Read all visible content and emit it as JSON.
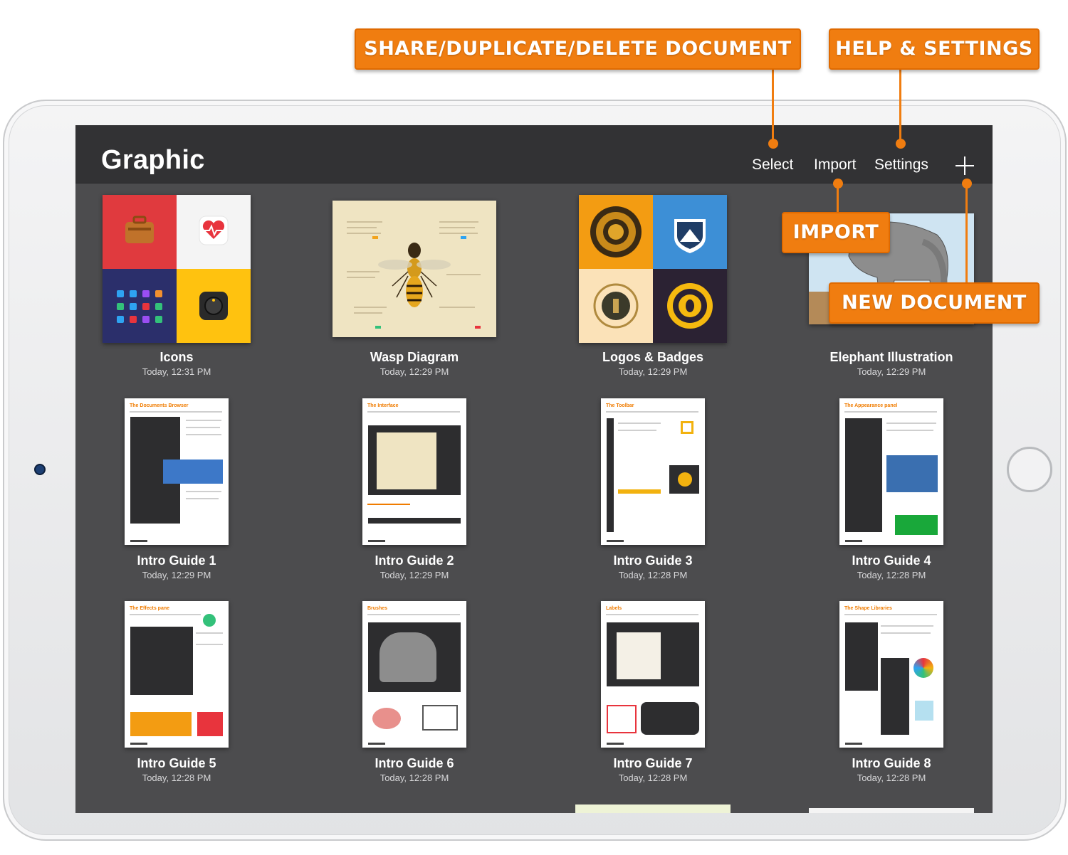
{
  "app": {
    "title": "Graphic"
  },
  "toolbar": {
    "select_label": "Select",
    "import_label": "Import",
    "settings_label": "Settings",
    "new_icon": "plus-icon"
  },
  "documents": [
    {
      "name": "Icons",
      "date": "Today, 12:31 PM"
    },
    {
      "name": "Wasp Diagram",
      "date": "Today, 12:29 PM"
    },
    {
      "name": "Logos & Badges",
      "date": "Today, 12:29 PM"
    },
    {
      "name": "Elephant Illustration",
      "date": "Today, 12:29 PM"
    },
    {
      "name": "Intro Guide 1",
      "date": "Today, 12:29 PM",
      "page_title": "The Documents Browser"
    },
    {
      "name": "Intro Guide 2",
      "date": "Today, 12:29 PM",
      "page_title": "The Interface"
    },
    {
      "name": "Intro Guide 3",
      "date": "Today, 12:28 PM",
      "page_title": "The Toolbar"
    },
    {
      "name": "Intro Guide 4",
      "date": "Today, 12:28 PM",
      "page_title": "The Appearance panel"
    },
    {
      "name": "Intro Guide 5",
      "date": "Today, 12:28 PM",
      "page_title": "The Effects pane"
    },
    {
      "name": "Intro Guide 6",
      "date": "Today, 12:28 PM",
      "page_title": "Brushes"
    },
    {
      "name": "Intro Guide 7",
      "date": "Today, 12:28 PM",
      "page_title": "Labels"
    },
    {
      "name": "Intro Guide 8",
      "date": "Today, 12:28 PM",
      "page_title": "The Shape Libraries"
    }
  ],
  "callouts": {
    "share": "SHARE/DUPLICATE/DELETE DOCUMENT",
    "help": "HELP & SETTINGS",
    "import": "IMPORT",
    "new_document": "NEW DOCUMENT"
  },
  "colors": {
    "callout": "#f07d10",
    "screen_bg": "#4c4c4e",
    "topbar_bg": "#323234",
    "page_accent": "#f07c00"
  }
}
